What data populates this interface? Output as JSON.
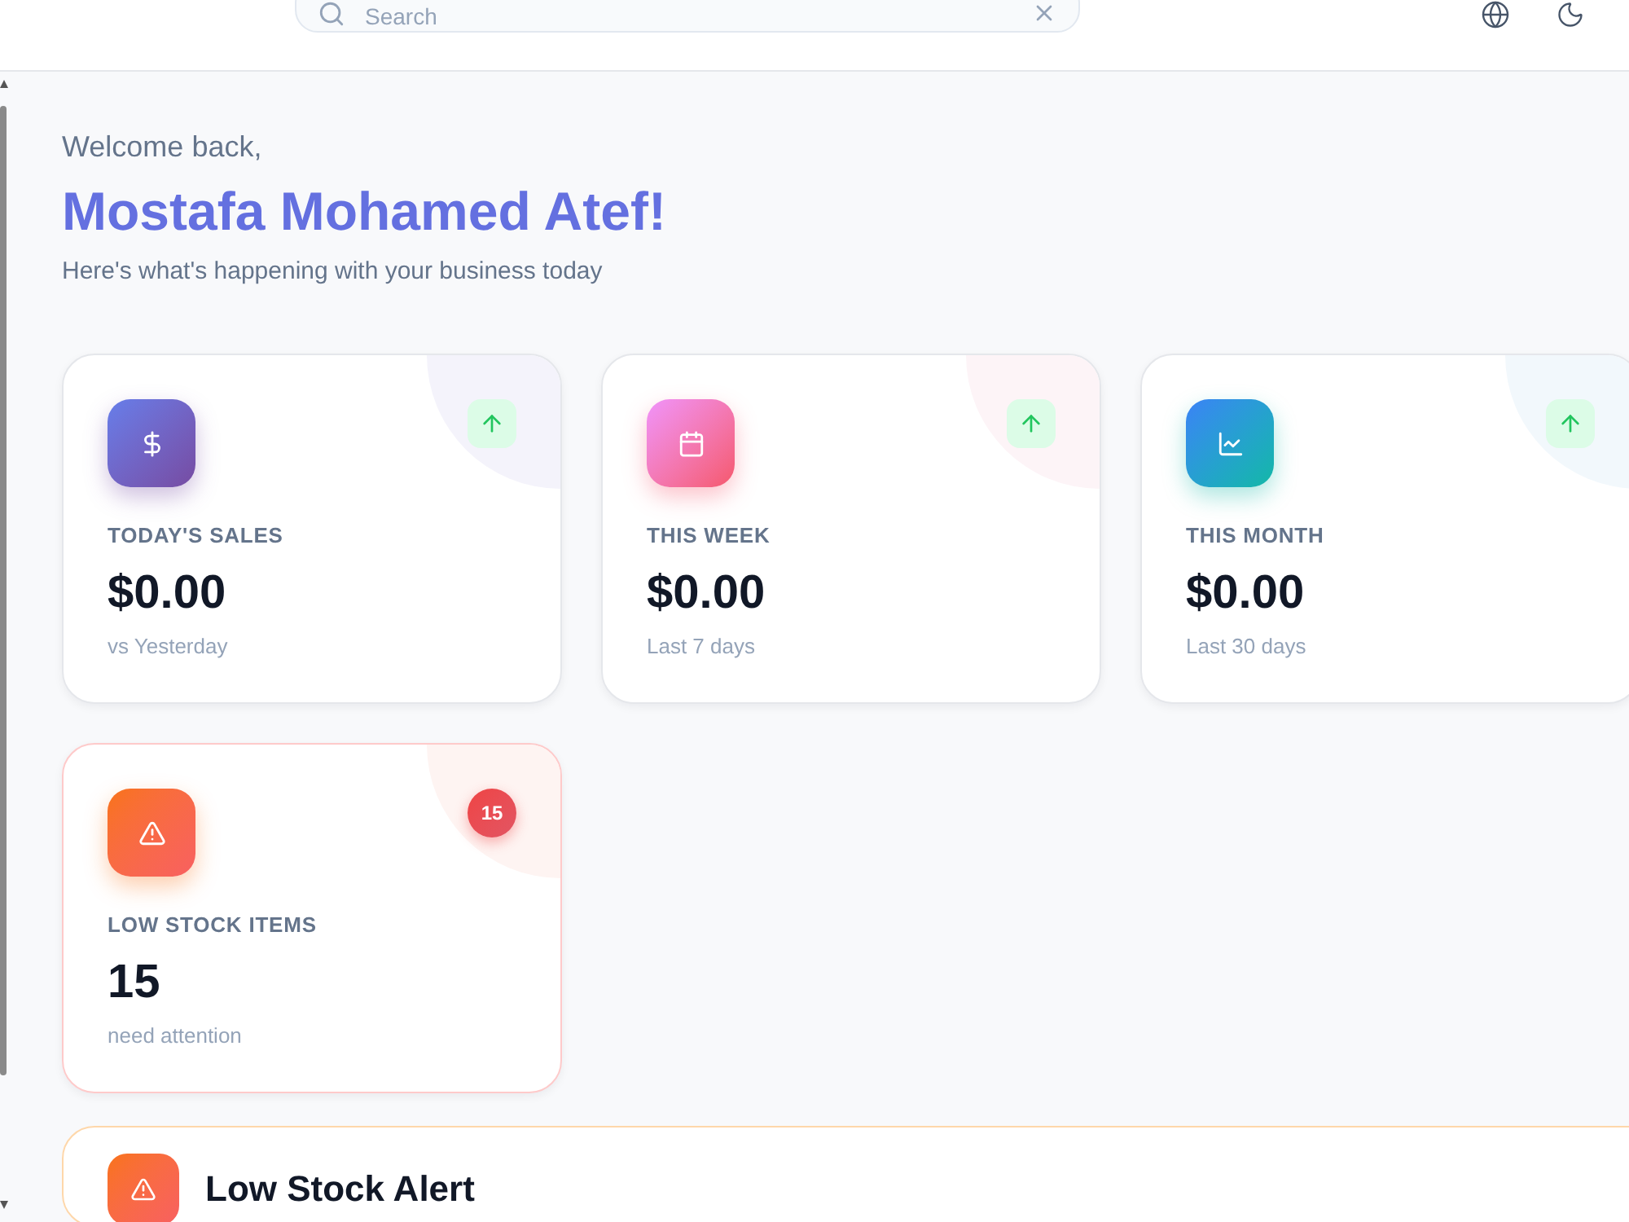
{
  "header": {
    "search": {
      "placeholder": "Search"
    }
  },
  "welcome": {
    "greeting": "Welcome back,",
    "name": "Mostafa Mohamed Atef!",
    "subtitle": "Here's what's happening with your business today"
  },
  "stats": [
    {
      "kind": "trend",
      "label": "TODAY'S SALES",
      "value": "$0.00",
      "note": "vs Yesterday"
    },
    {
      "kind": "trend",
      "label": "THIS WEEK",
      "value": "$0.00",
      "note": "Last 7 days"
    },
    {
      "kind": "trend",
      "label": "THIS MONTH",
      "value": "$0.00",
      "note": "Last 30 days"
    },
    {
      "kind": "alert",
      "label": "LOW STOCK ITEMS",
      "value": "15",
      "note": "need attention",
      "badge": "15"
    }
  ],
  "alert_panel": {
    "title": "Low Stock Alert"
  }
}
